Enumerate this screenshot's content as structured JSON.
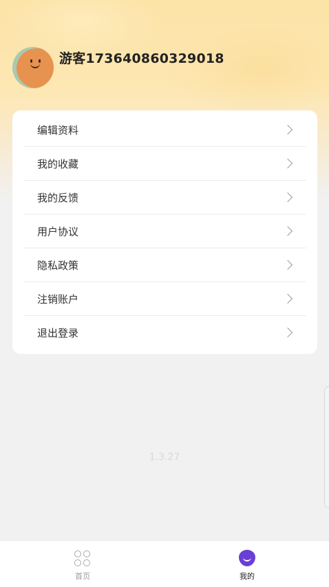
{
  "profile": {
    "username": "游客17364086032 9018"
  },
  "menu": {
    "items": [
      {
        "label": "编辑资料"
      },
      {
        "label": "我的收藏"
      },
      {
        "label": "我的反馈"
      },
      {
        "label": "用户协议"
      },
      {
        "label": "隐私政策"
      },
      {
        "label": "注销账户"
      },
      {
        "label": "退出登录"
      }
    ]
  },
  "version": "1.3.27",
  "tabbar": {
    "home": {
      "label": "首页",
      "icon": "grid-icon"
    },
    "mine": {
      "label": "我的",
      "icon": "smile-icon",
      "active": true
    }
  },
  "colors": {
    "accent": "#6a3fd6",
    "header": "#fce3a6"
  }
}
